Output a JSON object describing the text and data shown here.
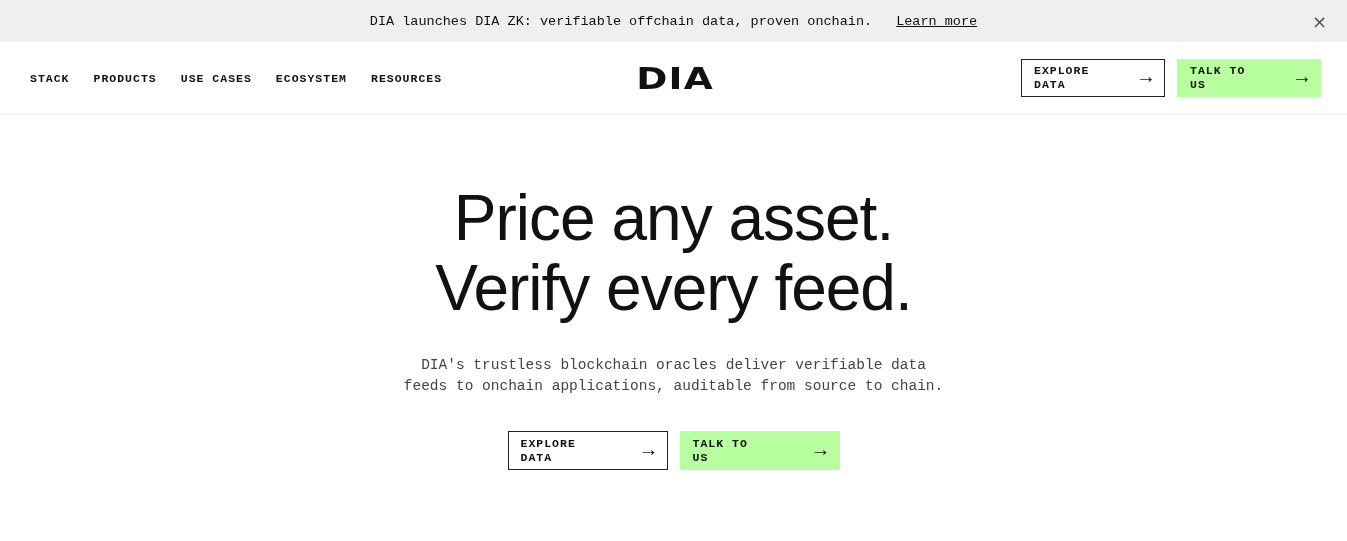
{
  "announcement": {
    "text": "DIA launches DIA ZK: verifiable offchain data, proven onchain.",
    "link": "Learn more",
    "close": "×"
  },
  "nav": {
    "links": [
      "STACK",
      "PRODUCTS",
      "USE CASES",
      "ECOSYSTEM",
      "RESOURCES"
    ],
    "logo": "DIA",
    "buttons": [
      {
        "label": "EXPLORE DATA",
        "kind": "outline",
        "arrow": "→"
      },
      {
        "label": "TALK TO US",
        "kind": "primary",
        "arrow": "→"
      }
    ]
  },
  "hero": {
    "title_lines": [
      "Price any asset.",
      "Verify every feed."
    ],
    "description": "DIA's trustless blockchain oracles deliver verifiable data feeds to onchain applications, auditable from source to chain.",
    "buttons": [
      {
        "label": "EXPLORE DATA",
        "kind": "outline",
        "arrow": "→"
      },
      {
        "label": "TALK TO US",
        "kind": "primary",
        "arrow": "→"
      }
    ]
  }
}
